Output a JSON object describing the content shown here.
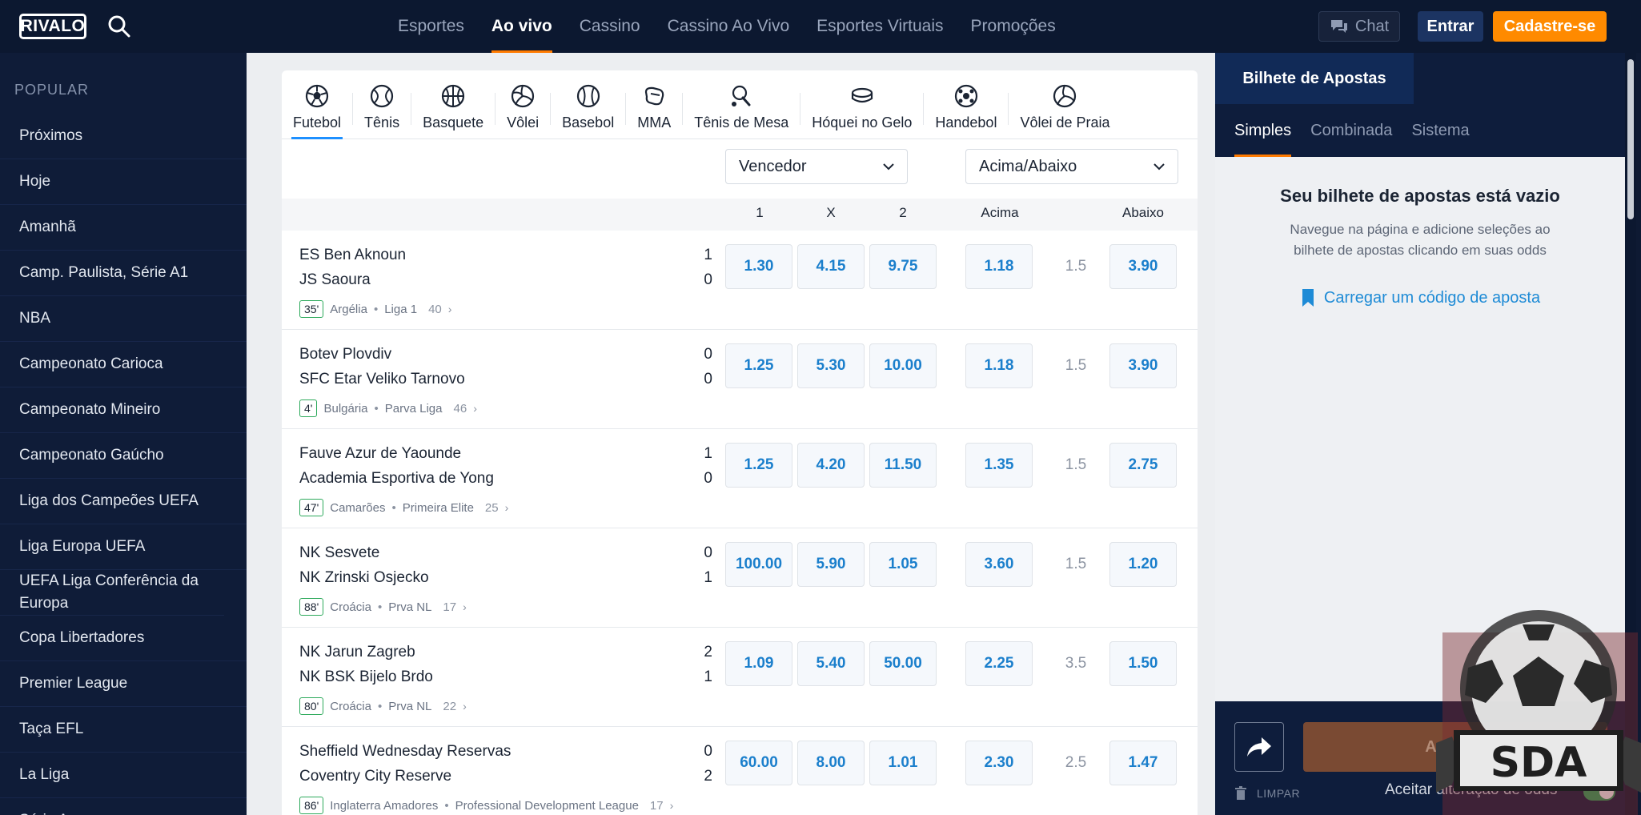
{
  "header": {
    "logo": "RIVALO",
    "nav": [
      "Esportes",
      "Ao vivo",
      "Cassino",
      "Cassino Ao Vivo",
      "Esportes Virtuais",
      "Promoções"
    ],
    "active_nav": "Ao vivo",
    "chat_label": "Chat",
    "login_label": "Entrar",
    "signup_label": "Cadastre-se",
    "accent_color": "#ff8a00"
  },
  "sidebar": {
    "heading": "POPULAR",
    "items": [
      "Próximos",
      "Hoje",
      "Amanhã",
      "Camp. Paulista, Série A1",
      "NBA",
      "Campeonato Carioca",
      "Campeonato Mineiro",
      "Campeonato Gaúcho",
      "Liga dos Campeões UEFA",
      "Liga Europa UEFA",
      "UEFA Liga Conferência da Europa",
      "Copa Libertadores",
      "Premier League",
      "Taça EFL",
      "La Liga",
      "Série A"
    ]
  },
  "sports": [
    {
      "label": "Futebol",
      "icon": "soccer-ball-icon"
    },
    {
      "label": "Tênis",
      "icon": "tennis-ball-icon"
    },
    {
      "label": "Basquete",
      "icon": "basketball-icon"
    },
    {
      "label": "Vôlei",
      "icon": "volleyball-icon"
    },
    {
      "label": "Basebol",
      "icon": "baseball-icon"
    },
    {
      "label": "MMA",
      "icon": "mma-glove-icon"
    },
    {
      "label": "Tênis de Mesa",
      "icon": "table-tennis-icon"
    },
    {
      "label": "Hóquei no Gelo",
      "icon": "hockey-puck-icon"
    },
    {
      "label": "Handebol",
      "icon": "handball-icon"
    },
    {
      "label": "Vôlei de Praia",
      "icon": "beach-volleyball-icon"
    }
  ],
  "filters": {
    "market1": "Vencedor",
    "market2": "Acima/Abaixo"
  },
  "columns": {
    "c1": "1",
    "cx": "X",
    "c2": "2",
    "over": "Acima",
    "under": "Abaixo"
  },
  "matches": [
    {
      "home": "ES Ben Aknoun",
      "away": "JS Saoura",
      "score_home": "1",
      "score_away": "0",
      "minute": "35'",
      "country": "Argélia",
      "league": "Liga 1",
      "count": "40",
      "o1": "1.30",
      "ox": "4.15",
      "o2": "9.75",
      "over": "1.18",
      "line": "1.5",
      "under": "3.90"
    },
    {
      "home": "Botev Plovdiv",
      "away": "SFC Etar Veliko Tarnovo",
      "score_home": "0",
      "score_away": "0",
      "minute": "4'",
      "country": "Bulgária",
      "league": "Parva Liga",
      "count": "46",
      "o1": "1.25",
      "ox": "5.30",
      "o2": "10.00",
      "over": "1.18",
      "line": "1.5",
      "under": "3.90"
    },
    {
      "home": "Fauve Azur de Yaounde",
      "away": "Academia Esportiva de Yong",
      "score_home": "1",
      "score_away": "0",
      "minute": "47'",
      "country": "Camarões",
      "league": "Primeira Elite",
      "count": "25",
      "o1": "1.25",
      "ox": "4.20",
      "o2": "11.50",
      "over": "1.35",
      "line": "1.5",
      "under": "2.75"
    },
    {
      "home": "NK Sesvete",
      "away": "NK Zrinski Osjecko",
      "score_home": "0",
      "score_away": "1",
      "minute": "88'",
      "country": "Croácia",
      "league": "Prva NL",
      "count": "17",
      "o1": "100.00",
      "ox": "5.90",
      "o2": "1.05",
      "over": "3.60",
      "line": "1.5",
      "under": "1.20"
    },
    {
      "home": "NK Jarun Zagreb",
      "away": "NK BSK Bijelo Brdo",
      "score_home": "2",
      "score_away": "1",
      "minute": "80'",
      "country": "Croácia",
      "league": "Prva NL",
      "count": "22",
      "o1": "1.09",
      "ox": "5.40",
      "o2": "50.00",
      "over": "2.25",
      "line": "3.5",
      "under": "1.50"
    },
    {
      "home": "Sheffield Wednesday Reservas",
      "away": "Coventry City Reserve",
      "score_home": "0",
      "score_away": "2",
      "minute": "86'",
      "country": "Inglaterra Amadores",
      "league": "Professional Development League",
      "count": "17",
      "o1": "60.00",
      "ox": "8.00",
      "o2": "1.01",
      "over": "2.30",
      "line": "2.5",
      "under": "1.47"
    }
  ],
  "betslip": {
    "title": "Bilhete de Apostas",
    "tabs": [
      "Simples",
      "Combinada",
      "Sistema"
    ],
    "empty_title": "Seu bilhete de apostas está vazio",
    "empty_desc": "Navegue na página e adicione seleções ao bilhete de apostas clicando em suas odds",
    "load_code": "Carregar um código de aposta",
    "bet_label": "Apostar",
    "clear_label": "LIMPAR",
    "accept_label": "Aceitar alteração de odds"
  },
  "watermark": {
    "text": "SDA"
  }
}
